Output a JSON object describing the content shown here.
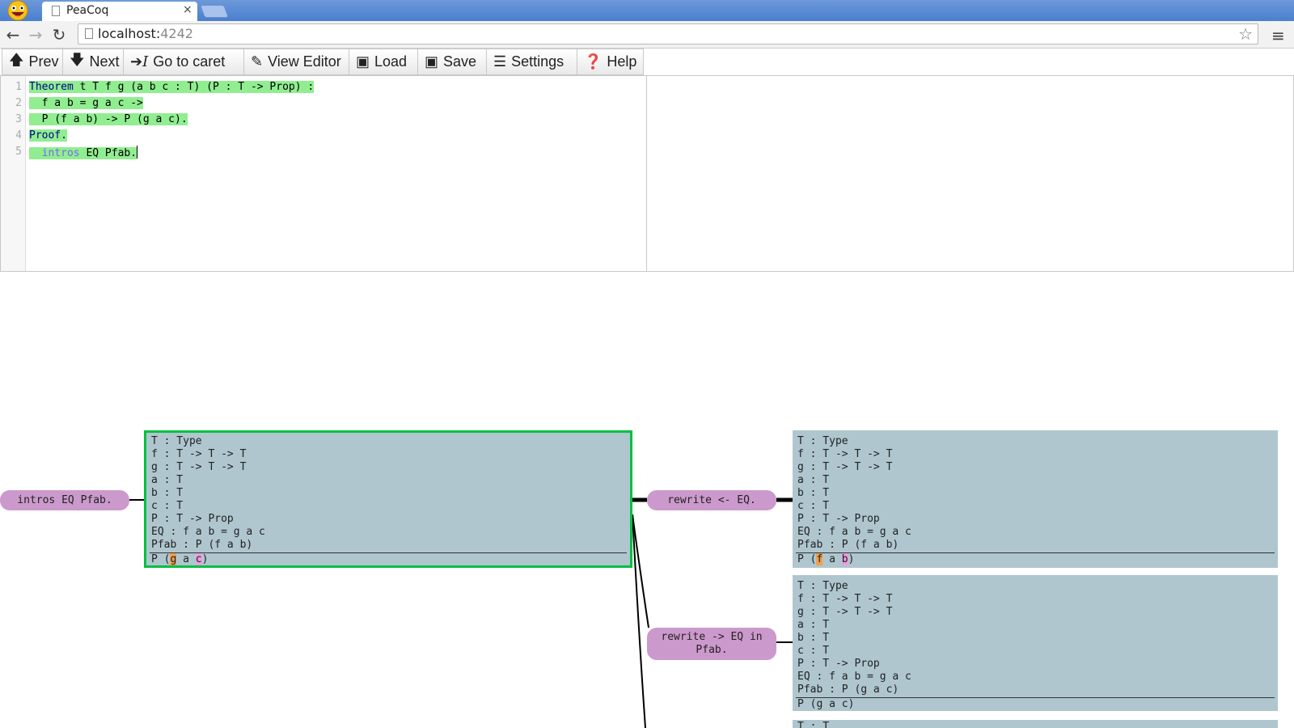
{
  "browser": {
    "tab_title": "PeaCoq",
    "tab_close": "×",
    "url_host": "localhost:",
    "url_port": "4242"
  },
  "toolbar": {
    "buttons": [
      {
        "label": "Prev",
        "icon": "arrow-up-icon"
      },
      {
        "label": "Next",
        "icon": "arrow-down-icon"
      },
      {
        "label": "Go to caret",
        "icon": "goto-caret-icon"
      },
      {
        "label": "View Editor",
        "icon": "edit-icon"
      },
      {
        "label": "Load",
        "icon": "load-icon"
      },
      {
        "label": "Save",
        "icon": "save-icon"
      },
      {
        "label": "Settings",
        "icon": "list-icon"
      },
      {
        "label": "Help",
        "icon": "help-icon"
      }
    ]
  },
  "editor": {
    "line_numbers": [
      "1",
      "2",
      "3",
      "4",
      "5"
    ],
    "line1_kw": "Theorem",
    "line1_rest": " t T f g (a b c : T) (P : T -> Prop) :",
    "line2": "  f a b = g a c ->",
    "line3": "  P (f a b) -> P (g a c).",
    "line4": "Proof.",
    "line5_indent": "  ",
    "line5_tac": "intros",
    "line5_rest": " EQ Pfab."
  },
  "tree": {
    "tactic_left": "intros EQ Pfab.",
    "tactic_right1": "rewrite <- EQ.",
    "tactic_right2": "rewrite -> EQ in Pfab.",
    "current_goal": {
      "hyps": [
        "T : Type",
        "f : T -> T -> T",
        "g : T -> T -> T",
        "a : T",
        "b : T",
        "c : T",
        "P : T -> Prop",
        "EQ : f a b = g a c",
        "Pfab : P (f a b)"
      ],
      "concl_pre": "P (",
      "concl_h1": "g",
      "concl_mid": " a ",
      "concl_h2": "c",
      "concl_post": ")"
    },
    "goal1": {
      "hyps": [
        "T : Type",
        "f : T -> T -> T",
        "g : T -> T -> T",
        "a : T",
        "b : T",
        "c : T",
        "P : T -> Prop",
        "EQ : f a b = g a c",
        "Pfab : P (f a b)"
      ],
      "concl_pre": "P (",
      "concl_h1": "f",
      "concl_mid": " a ",
      "concl_h2": "b",
      "concl_post": ")"
    },
    "goal2": {
      "hyps": [
        "T : Type",
        "f : T -> T -> T",
        "g : T -> T -> T",
        "a : T",
        "b : T",
        "c : T",
        "P : T -> Prop",
        "EQ : f a b = g a c",
        "Pfab : P (g a c)"
      ],
      "concl": "P (g a c)"
    },
    "goal3_peek": "T : T"
  },
  "colors": {
    "processed_highlight": "#90ee90",
    "goal_bg": "#afc6cf",
    "tactic_bg": "#cc99cc",
    "current_border": "#00c040"
  }
}
